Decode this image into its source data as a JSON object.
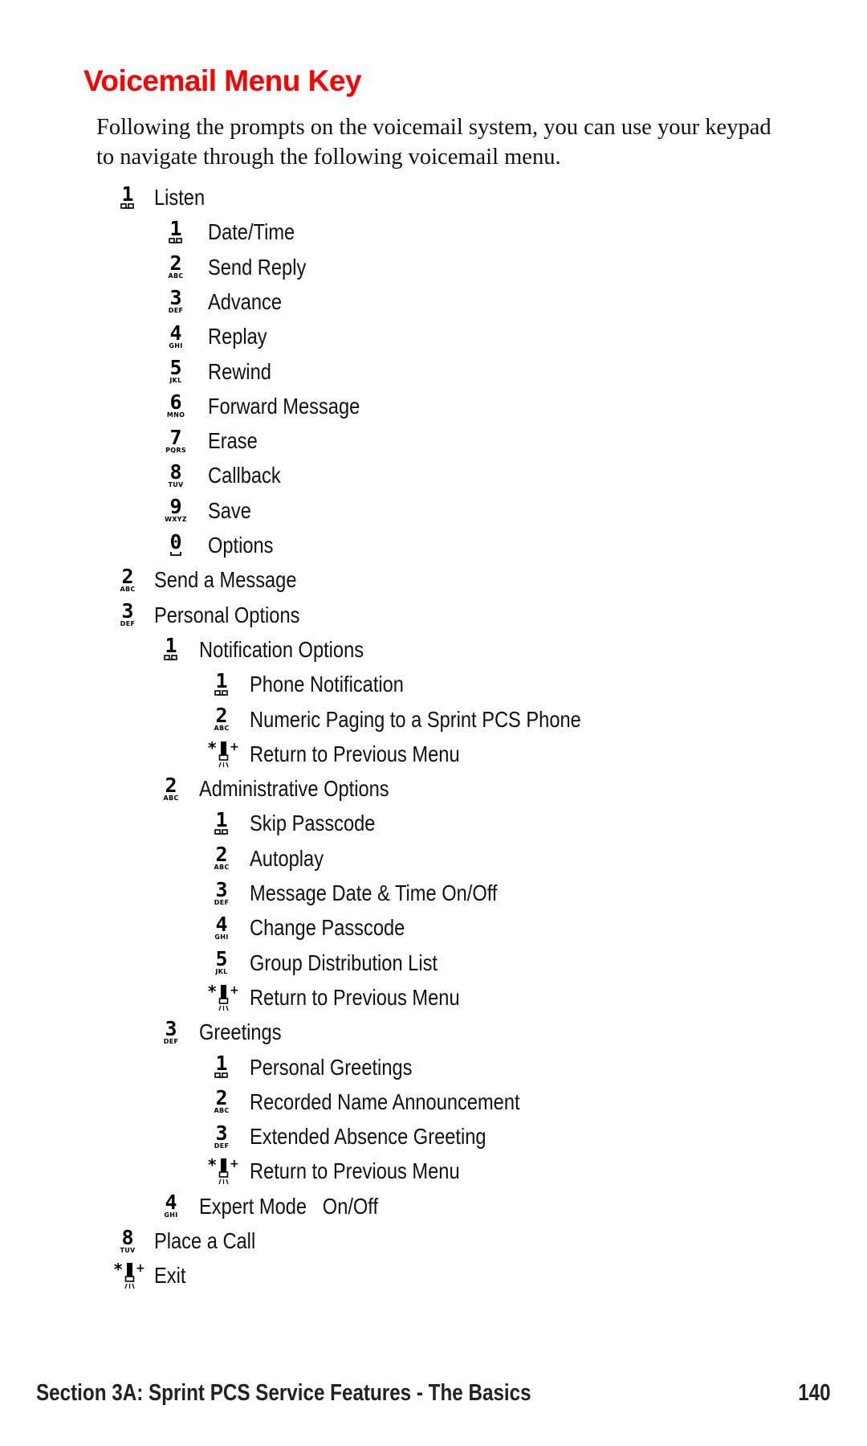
{
  "title": "Voicemail Menu Key",
  "intro": "Following the prompts on the voicemail system, you can use your keypad to navigate through the following voicemail menu.",
  "menu": [
    {
      "level": 1,
      "key": "1",
      "letters": "oo",
      "label": "Listen"
    },
    {
      "level": 2,
      "key": "1",
      "letters": "oo",
      "label": "Date/Time"
    },
    {
      "level": 2,
      "key": "2",
      "letters": "ABC",
      "label": "Send Reply"
    },
    {
      "level": 2,
      "key": "3",
      "letters": "DEF",
      "label": "Advance"
    },
    {
      "level": 2,
      "key": "4",
      "letters": "GHI",
      "label": "Replay"
    },
    {
      "level": 2,
      "key": "5",
      "letters": "JKL",
      "label": "Rewind"
    },
    {
      "level": 2,
      "key": "6",
      "letters": "MNO",
      "label": "Forward Message"
    },
    {
      "level": 2,
      "key": "7",
      "letters": "PQRS",
      "label": "Erase"
    },
    {
      "level": 2,
      "key": "8",
      "letters": "TUV",
      "label": "Callback"
    },
    {
      "level": 2,
      "key": "9",
      "letters": "WXYZ",
      "label": "Save"
    },
    {
      "level": 2,
      "key": "0",
      "letters": "␣",
      "label": "Options"
    },
    {
      "level": 1,
      "key": "2",
      "letters": "ABC",
      "label": "Send a Message"
    },
    {
      "level": 1,
      "key": "3",
      "letters": "DEF",
      "label": "Personal Options"
    },
    {
      "level": 3,
      "key": "1",
      "letters": "oo",
      "label": "Notification Options"
    },
    {
      "level": 4,
      "key": "1",
      "letters": "oo",
      "label": "Phone Notification"
    },
    {
      "level": 4,
      "key": "2",
      "letters": "ABC",
      "label": "Numeric Paging to a Sprint PCS Phone"
    },
    {
      "level": 4,
      "key": "*",
      "letters": "",
      "label": "Return to Previous Menu"
    },
    {
      "level": 3,
      "key": "2",
      "letters": "ABC",
      "label": "Administrative Options"
    },
    {
      "level": 4,
      "key": "1",
      "letters": "oo",
      "label": "Skip Passcode"
    },
    {
      "level": 4,
      "key": "2",
      "letters": "ABC",
      "label": "Autoplay"
    },
    {
      "level": 4,
      "key": "3",
      "letters": "DEF",
      "label": "Message Date & Time On/Off"
    },
    {
      "level": 4,
      "key": "4",
      "letters": "GHI",
      "label": "Change Passcode"
    },
    {
      "level": 4,
      "key": "5",
      "letters": "JKL",
      "label": "Group Distribution List"
    },
    {
      "level": 4,
      "key": "*",
      "letters": "",
      "label": "Return to Previous Menu"
    },
    {
      "level": 3,
      "key": "3",
      "letters": "DEF",
      "label": "Greetings"
    },
    {
      "level": 4,
      "key": "1",
      "letters": "oo",
      "label": "Personal Greetings"
    },
    {
      "level": 4,
      "key": "2",
      "letters": "ABC",
      "label": "Recorded Name Announcement"
    },
    {
      "level": 4,
      "key": "3",
      "letters": "DEF",
      "label": "Extended Absence Greeting"
    },
    {
      "level": 4,
      "key": "*",
      "letters": "",
      "label": "Return to Previous Menu"
    },
    {
      "level": 3,
      "key": "4",
      "letters": "GHI",
      "label": "Expert Mode   On/Off"
    },
    {
      "level": 1,
      "key": "8",
      "letters": "TUV",
      "label": "Place a Call"
    },
    {
      "level": 1,
      "key": "*",
      "letters": "",
      "label": "Exit"
    }
  ],
  "footer": {
    "section": "Section 3A: Sprint PCS Service Features - The Basics",
    "page": "140"
  }
}
